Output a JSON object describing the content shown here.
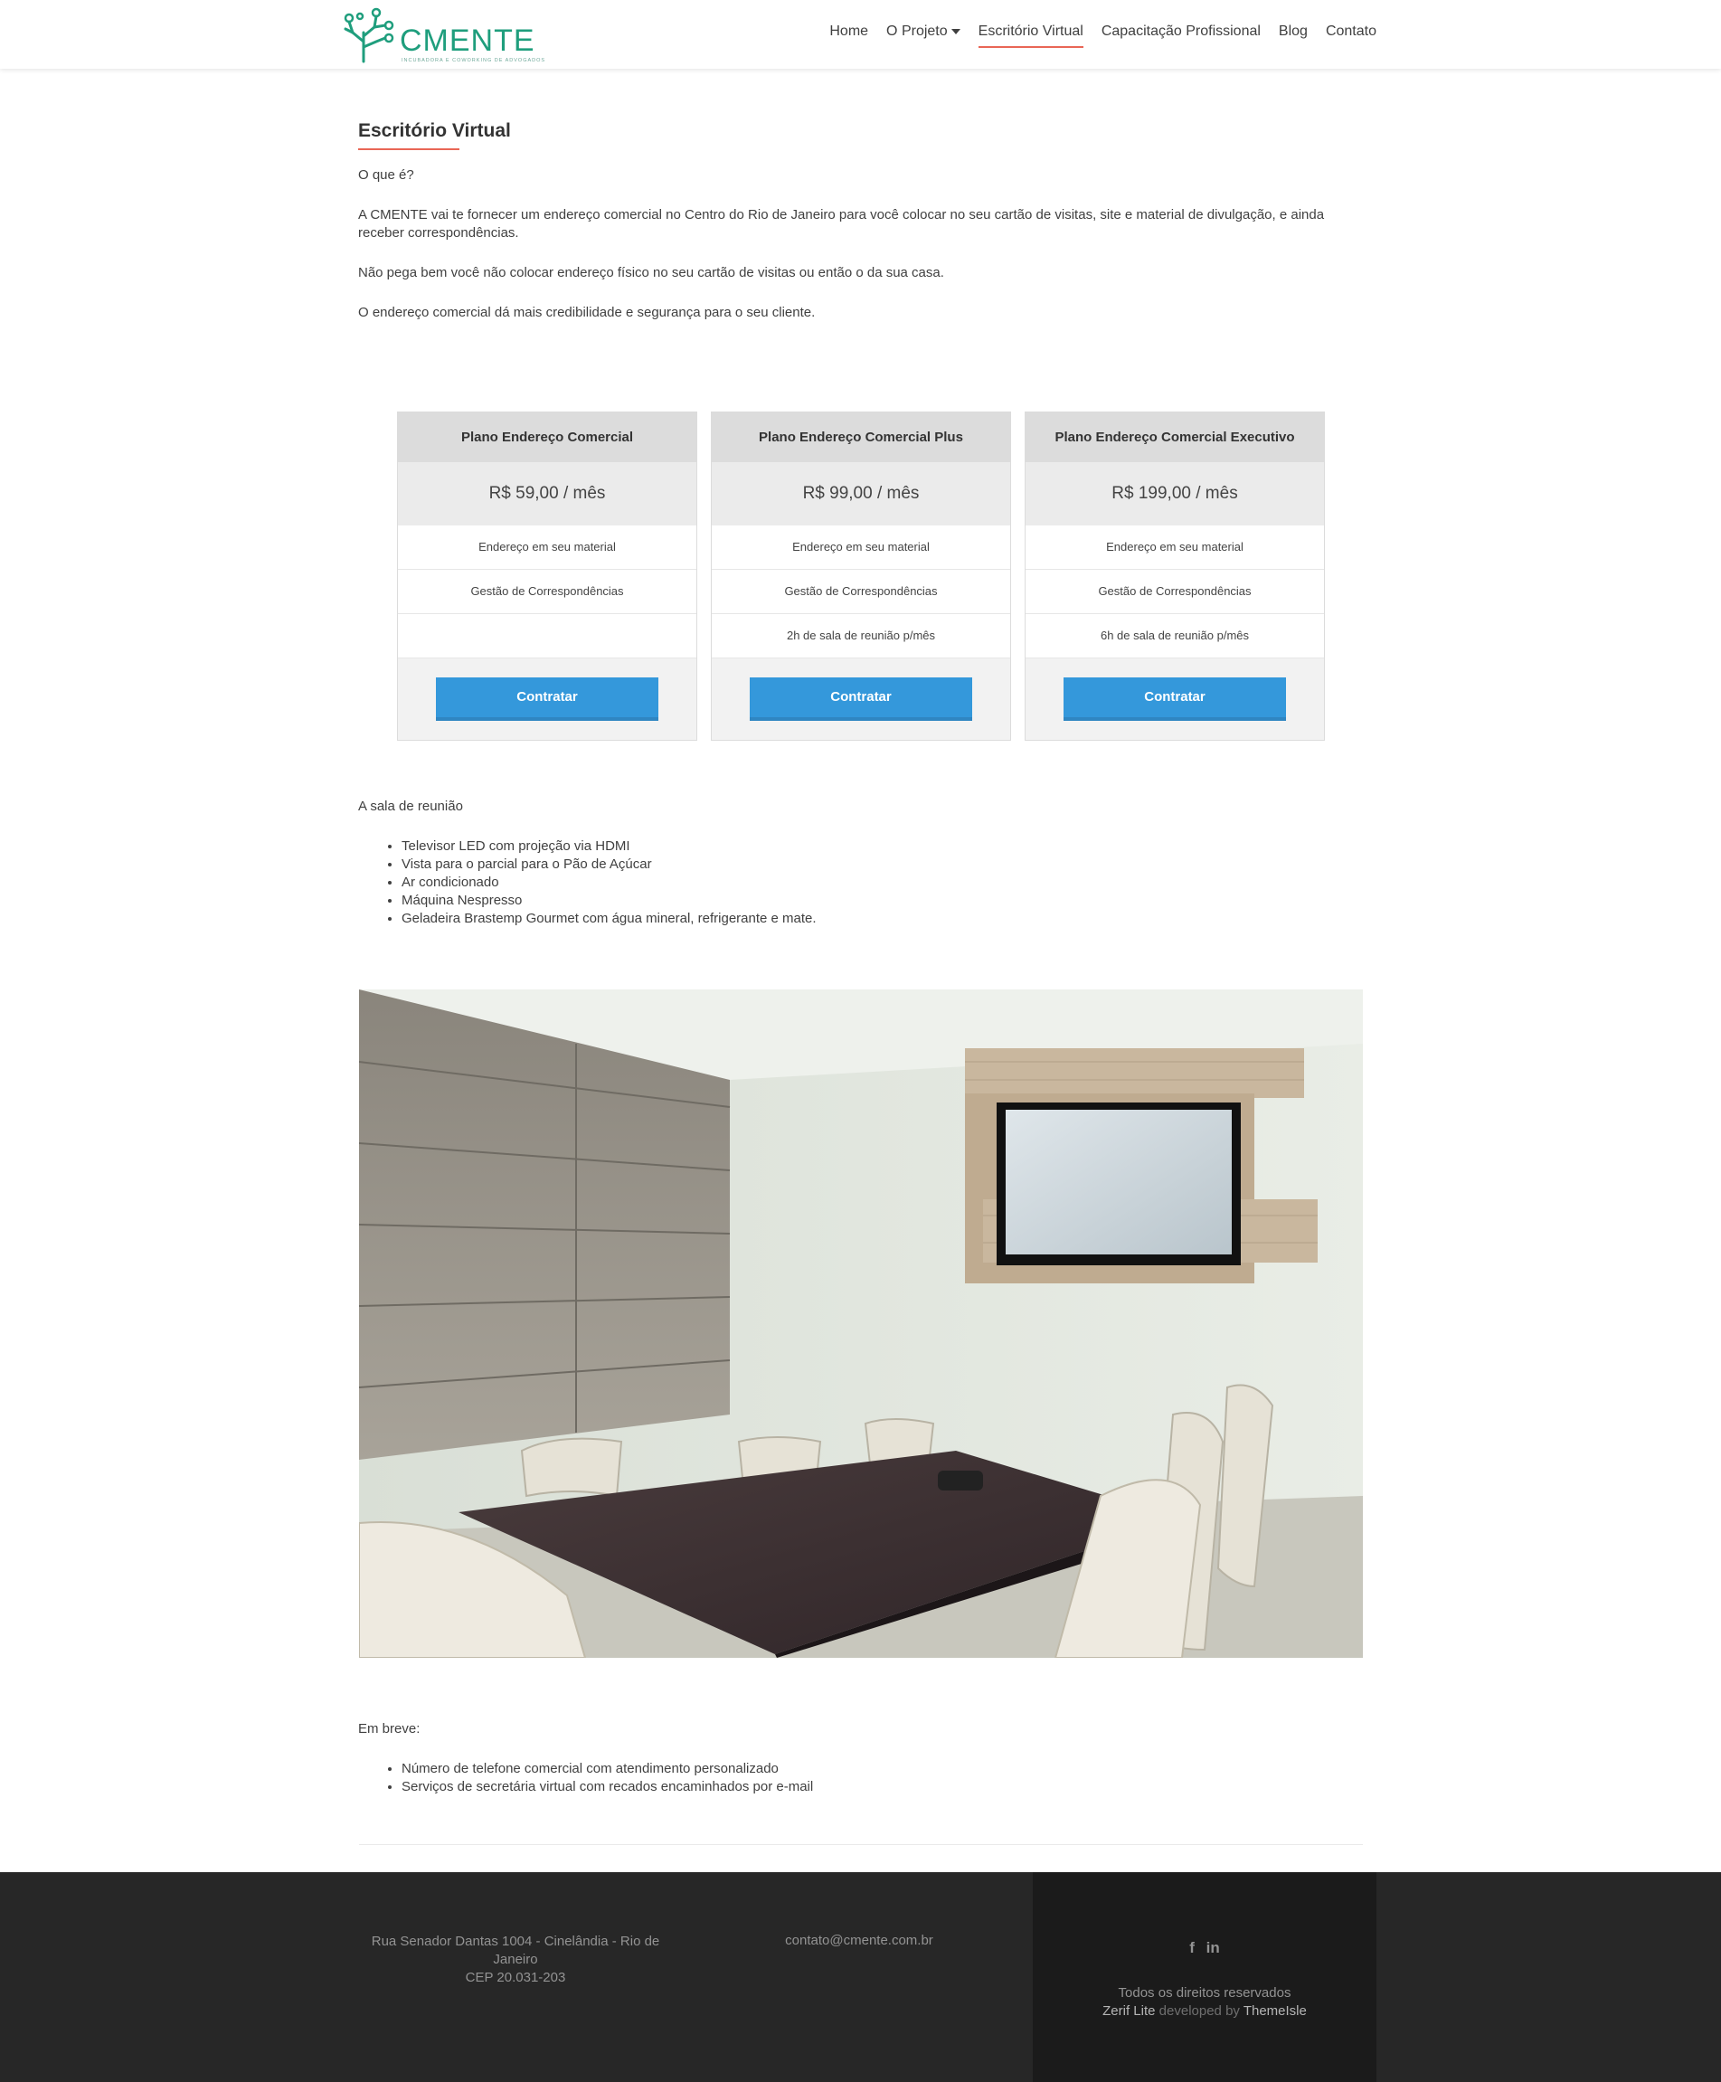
{
  "header": {
    "logo_text": "CMENTE",
    "logo_tagline": "INCUBADORA E COWORKING DE ADVOGADOS",
    "nav": [
      {
        "label": "Home"
      },
      {
        "label": "O Projeto"
      },
      {
        "label": "Escritório Virtual"
      },
      {
        "label": "Capacitação Profissional"
      },
      {
        "label": "Blog"
      },
      {
        "label": "Contato"
      }
    ]
  },
  "page": {
    "title": "Escritório Virtual",
    "intro_q": "O que é?",
    "intro_p1": "A CMENTE vai te fornecer um endereço comercial no Centro do Rio de Janeiro para você colocar no seu cartão de visitas, site e material de divulgação, e ainda receber correspondências.",
    "intro_p2": "Não pega bem você não colocar endereço físico no seu cartão de visitas ou então o da sua casa.",
    "intro_p3": "O endereço comercial dá mais credibilidade e segurança para o seu cliente."
  },
  "plans": [
    {
      "name": "Plano Endereço Comercial",
      "price": "R$ 59,00 / mês",
      "features": [
        "Endereço em seu material",
        "Gestão de Correspondências",
        ""
      ],
      "button": "Contratar"
    },
    {
      "name": "Plano Endereço Comercial Plus",
      "price": "R$ 99,00 / mês",
      "features": [
        "Endereço em seu material",
        "Gestão de Correspondências",
        "2h de sala de reunião p/mês"
      ],
      "button": "Contratar"
    },
    {
      "name": "Plano Endereço Comercial Executivo",
      "price": "R$ 199,00 / mês",
      "features": [
        "Endereço em seu material",
        "Gestão de Correspondências",
        "6h de sala de reunião p/mês"
      ],
      "button": "Contratar"
    }
  ],
  "meeting_room": {
    "heading": "A sala de reunião",
    "items": [
      "Televisor LED com projeção via HDMI",
      "Vista para o parcial para o Pão de Açúcar",
      "Ar condicionado",
      "Máquina Nespresso",
      "Geladeira Brastemp Gourmet com água mineral, refrigerante e mate."
    ]
  },
  "coming_soon": {
    "heading": "Em breve:",
    "items": [
      "Número de telefone comercial com atendimento personalizado",
      "Serviços de secretária virtual com recados encaminhados por e-mail"
    ]
  },
  "footer": {
    "address_line1": "Rua Senador Dantas 1004 - Cinelândia - Rio de Janeiro",
    "address_line2": "CEP 20.031-203",
    "email": "contato@cmente.com.br",
    "social": [
      "f",
      "in"
    ],
    "copyright": "Todos os direitos reservados",
    "credit_theme": "Zerif Lite",
    "credit_mid": "developed by",
    "credit_author": "ThemeIsle"
  },
  "colors": {
    "accent": "#e96656",
    "button": "#3498db",
    "logo": "#1f9e7d",
    "footer_bg": "#272727"
  }
}
